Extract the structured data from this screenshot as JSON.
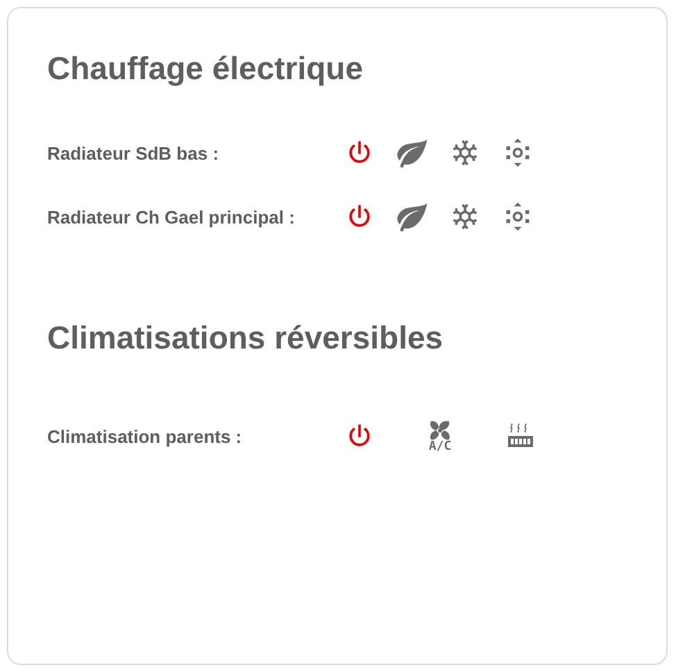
{
  "sections": [
    {
      "title": "Chauffage électrique",
      "kind": "heating",
      "rows": [
        {
          "label": "Radiateur SdB bas :",
          "buttons": [
            {
              "kind": "power",
              "selected": true
            },
            {
              "kind": "eco",
              "selected": false
            },
            {
              "kind": "frost",
              "selected": false
            },
            {
              "kind": "comfort",
              "selected": false
            }
          ]
        },
        {
          "label": "Radiateur Ch Gael principal :",
          "buttons": [
            {
              "kind": "power",
              "selected": true
            },
            {
              "kind": "eco",
              "selected": false
            },
            {
              "kind": "frost",
              "selected": false
            },
            {
              "kind": "comfort",
              "selected": false
            }
          ]
        }
      ]
    },
    {
      "title": "Climatisations réversibles",
      "kind": "climate",
      "rows": [
        {
          "label": "Climatisation parents :",
          "buttons": [
            {
              "kind": "power",
              "selected": true
            },
            {
              "kind": "ac",
              "label": "A/C",
              "selected": false
            },
            {
              "kind": "heat",
              "selected": false
            }
          ]
        }
      ]
    }
  ]
}
